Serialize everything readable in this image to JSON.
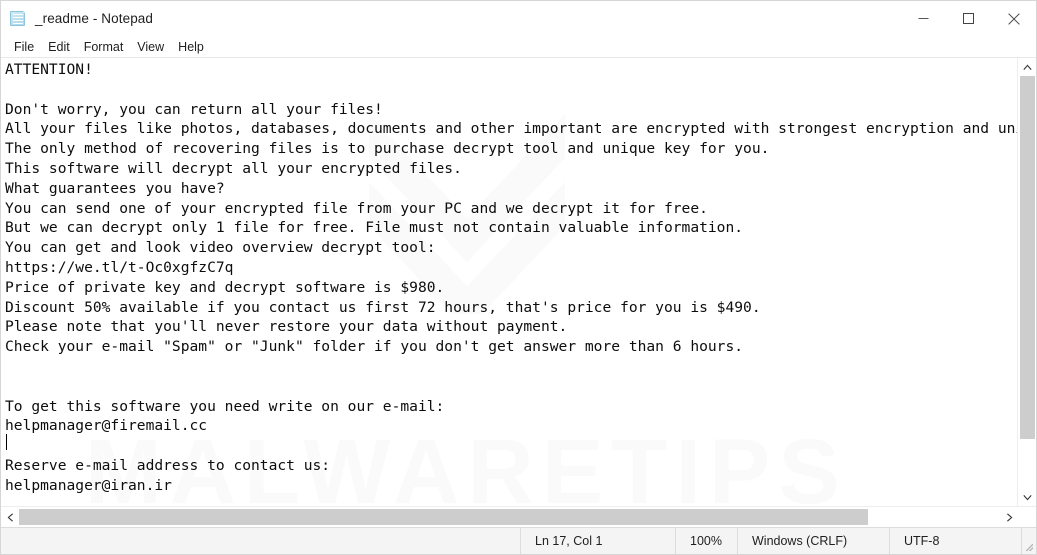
{
  "window": {
    "title": "_readme - Notepad",
    "icon": "notepad-document-icon",
    "controls": {
      "minimize": "minimize-icon",
      "maximize": "maximize-icon",
      "close": "close-icon"
    }
  },
  "menubar": {
    "items": [
      {
        "label": "File"
      },
      {
        "label": "Edit"
      },
      {
        "label": "Format"
      },
      {
        "label": "View"
      },
      {
        "label": "Help"
      }
    ]
  },
  "editor": {
    "watermark_text": "MALWARETIPS",
    "content": "ATTENTION!\n\nDon't worry, you can return all your files!\nAll your files like photos, databases, documents and other important are encrypted with strongest encryption and unique key.\nThe only method of recovering files is to purchase decrypt tool and unique key for you.\nThis software will decrypt all your encrypted files.\nWhat guarantees you have?\nYou can send one of your encrypted file from your PC and we decrypt it for free.\nBut we can decrypt only 1 file for free. File must not contain valuable information.\nYou can get and look video overview decrypt tool:\nhttps://we.tl/t-Oc0xgfzC7q\nPrice of private key and decrypt software is $980.\nDiscount 50% available if you contact us first 72 hours, that's price for you is $490.\nPlease note that you'll never restore your data without payment.\nCheck your e-mail \"Spam\" or \"Junk\" folder if you don't get answer more than 6 hours.\n\n\nTo get this software you need write on our e-mail:\nhelpmanager@firemail.cc\n\nReserve e-mail address to contact us:\nhelpmanager@iran.ir"
  },
  "scrollbars": {
    "vertical": {
      "up_arrow": "chevron-up-icon",
      "down_arrow": "chevron-down-icon"
    },
    "horizontal": {
      "left_arrow": "chevron-left-icon",
      "right_arrow": "chevron-right-icon"
    }
  },
  "statusbar": {
    "cursor_position": "Ln 17, Col 1",
    "zoom": "100%",
    "line_ending": "Windows (CRLF)",
    "encoding": "UTF-8"
  }
}
